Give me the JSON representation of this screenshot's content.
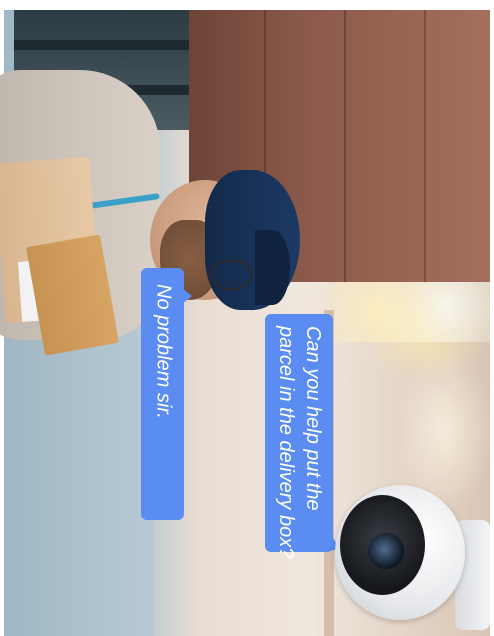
{
  "bubbles": {
    "reply": "No problem sir.",
    "question_line1": "Can you help put the",
    "question_line2": "parcel in the delivery box?"
  },
  "colors": {
    "bubble": "#5a8cf2",
    "bubble_text": "#ffffff"
  },
  "icons": [
    "security-camera-icon"
  ]
}
